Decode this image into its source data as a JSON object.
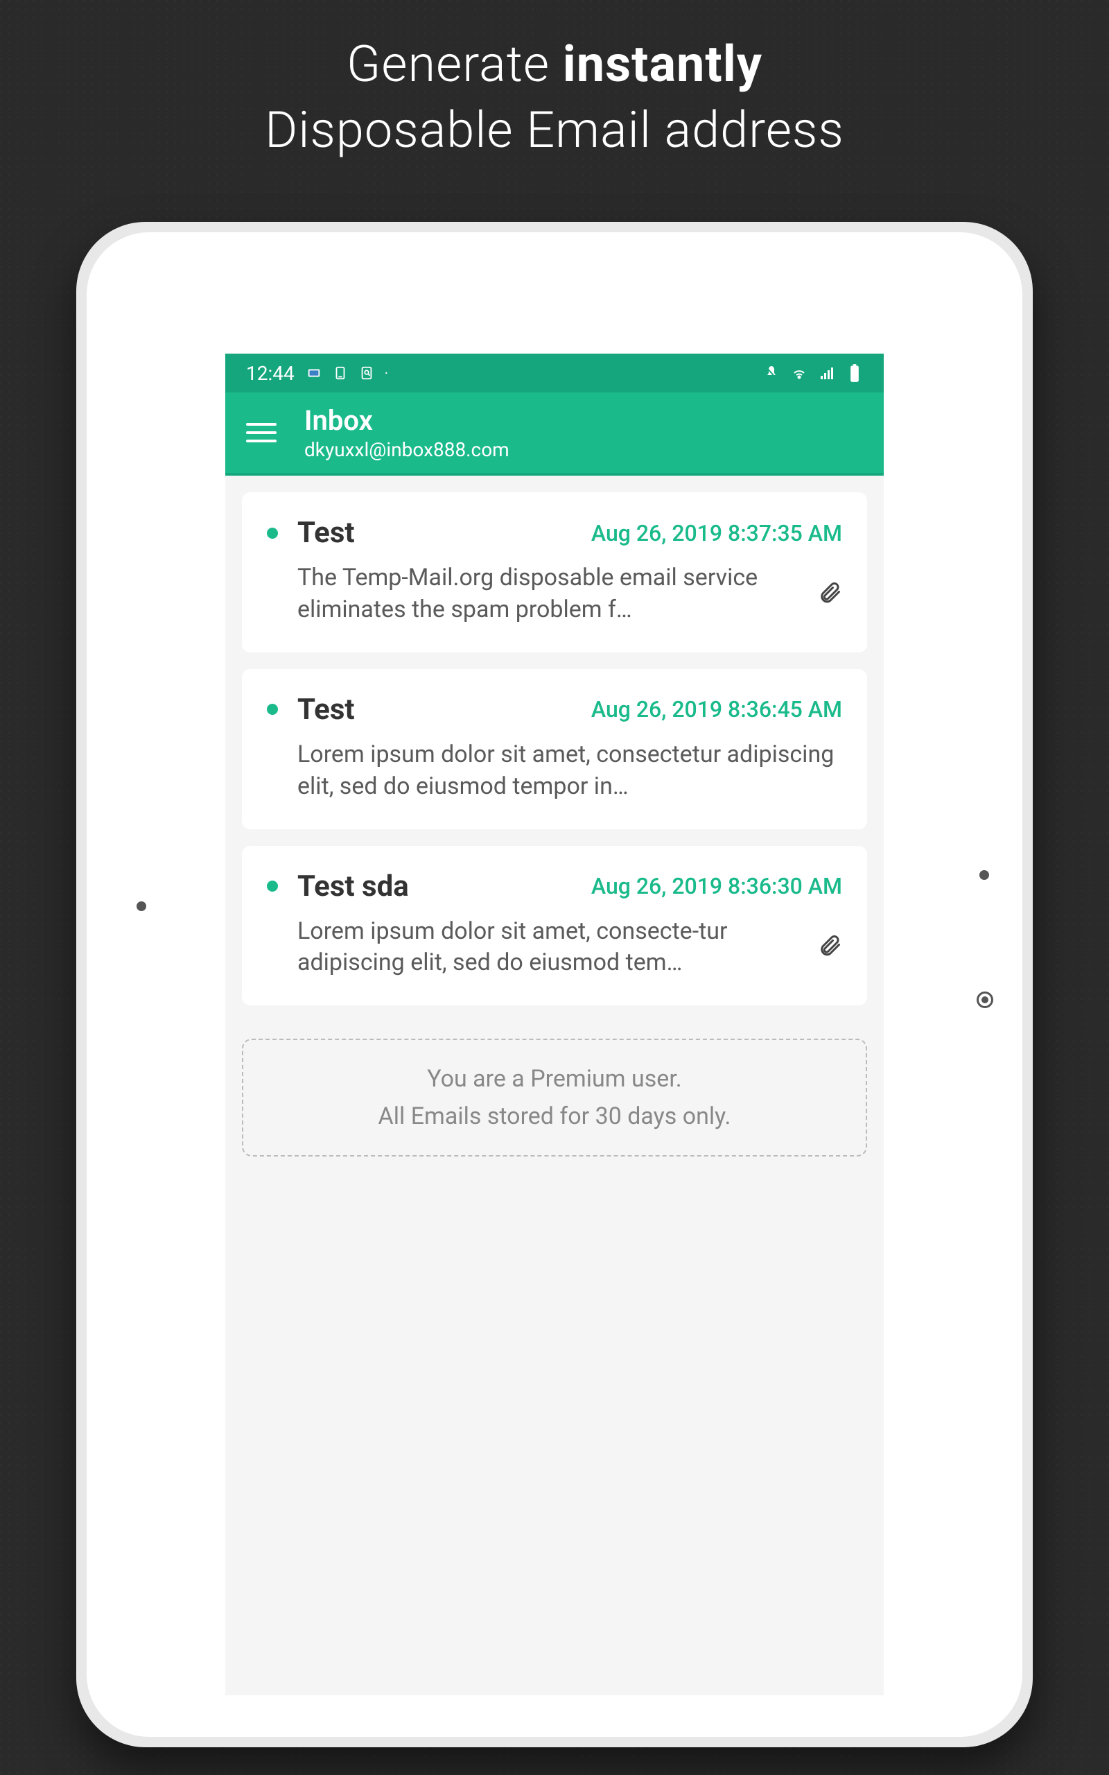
{
  "promo": {
    "line1_pre": "Generate ",
    "line1_bold": "instantly",
    "line2": "Disposable Email address"
  },
  "status_bar": {
    "time": "12:44"
  },
  "header": {
    "title": "Inbox",
    "email": "dkyuxxl@inbox888.com"
  },
  "emails": [
    {
      "sender": "Test",
      "time": "Aug 26, 2019 8:37:35 AM",
      "preview": "The Temp-Mail.org disposable email service eliminates the spam problem f…",
      "has_attachment": true
    },
    {
      "sender": "Test",
      "time": "Aug 26, 2019 8:36:45 AM",
      "preview": "Lorem ipsum dolor sit amet, consectetur adipiscing elit, sed do eiusmod tempor in…",
      "has_attachment": false
    },
    {
      "sender": "Test sda",
      "time": "Aug 26, 2019 8:36:30 AM",
      "preview": "Lorem ipsum dolor sit amet, consecte-tur adipiscing elit, sed do eiusmod tem…",
      "has_attachment": true
    }
  ],
  "premium": {
    "line1": "You are a Premium user.",
    "line2": "All Emails stored for 30 days only."
  }
}
